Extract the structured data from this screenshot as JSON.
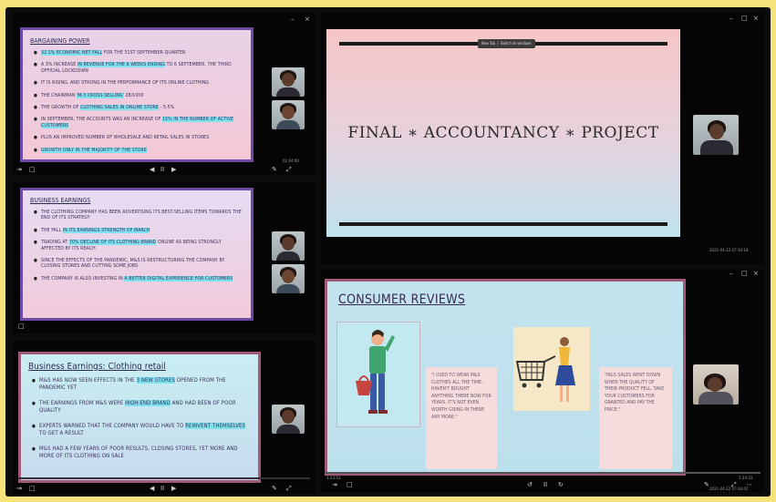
{
  "panel1": {
    "title": "Bargaining power",
    "bullets": [
      {
        "pre": "",
        "hl": "32.1% economic net fall",
        "post": " for the 31st September quarter"
      },
      {
        "pre": "A 3% increase ",
        "hl": "in revenue for the 6 weeks ending",
        "post": " to 6 September, the third official lockdown"
      },
      {
        "pre": "It is rising, and strong in the performance of its online clothing",
        "hl": "",
        "post": ""
      },
      {
        "pre": "The chairman ",
        "hl": "'M-3 Cross-selling'",
        "post": " 28/1000"
      },
      {
        "pre": "The growth of ",
        "hl": "clothing sales in online store",
        "post": " - 5.5%"
      },
      {
        "pre": "In September, the accounts was an increase of ",
        "hl": "15% in the number of active customers",
        "post": ""
      },
      {
        "pre": "Plus an improved number of wholesale and retail sales in stores",
        "hl": "",
        "post": ""
      },
      {
        "pre": "",
        "hl": "Growth only in the majority of the store",
        "post": ""
      }
    ],
    "controls": {
      "prev": "◀",
      "play": "II",
      "next": "▶",
      "left_icon": "⇥",
      "chat_icon": "□",
      "rec": "«",
      "time": "01:04:00"
    }
  },
  "panel2": {
    "title": "Business earnings",
    "bullets": [
      {
        "pre": "The clothing company has been advertising its best-selling items towards the end of its strategy",
        "hl": "",
        "post": ""
      },
      {
        "pre": "The fall ",
        "hl": "in its earnings strength of March",
        "post": ""
      },
      {
        "pre": "Trading at ",
        "hl": "70% decline of its clothing brand",
        "post": " online as being strongly affected by its reach"
      },
      {
        "pre": "Since the effects of the pandemic, M&S is restructuring the company by closing stores and cutting some jobs",
        "hl": "",
        "post": ""
      },
      {
        "pre": "The company is also investing in ",
        "hl": "a better digital experience for customers",
        "post": ""
      }
    ]
  },
  "panel3": {
    "title": "Business Earnings: Clothing retail",
    "bullets": [
      {
        "pre": "M&S has now seen effects in the ",
        "hl": "3 new stores",
        "post": " opened from the pandemic yet"
      },
      {
        "pre": "The earnings from M&S were ",
        "hl": "high-end brand",
        "post": " and had been of poor quality"
      },
      {
        "pre": "Experts warned that the company would have to ",
        "hl": "reinvent themselves",
        "post": " to get a result"
      },
      {
        "pre": "M&S had a few years of poor results, closing stores, yet more and more of its clothing on sale",
        "hl": "",
        "post": ""
      }
    ]
  },
  "main_slide": {
    "title": "Final ∗ Accountancy ∗ Project",
    "toolbar": {
      "opt1": "New Tab",
      "opt2": "Switch all windows"
    },
    "timestamp": "2021-04-22 07:34:18"
  },
  "review_slide": {
    "title": "Consumer reviews",
    "quote1": "\"I used to wear M&S clothes all the time - haven't bought anything there now for years. It's not even worth going in there any more.\"",
    "quote2": "\"M&S sales went down when the quality of their product fell. Take your customers for granted and pay the price.\"",
    "timestamp": "2021-04-22 07:34:42",
    "time_left": "1:23:53",
    "time_right": "1:24:31"
  },
  "window_controls": {
    "min": "–",
    "max": "□",
    "close": "×"
  },
  "icons": {
    "play": "II",
    "prev": "↺",
    "next": "↻",
    "pen": "✎",
    "expand": "⤢",
    "more": "⋯"
  },
  "colors": {
    "panel_border": "#7b54a8",
    "review_border": "#a35a78",
    "highlight": "#7fe1ee",
    "page_bg": "#f5e27a"
  }
}
